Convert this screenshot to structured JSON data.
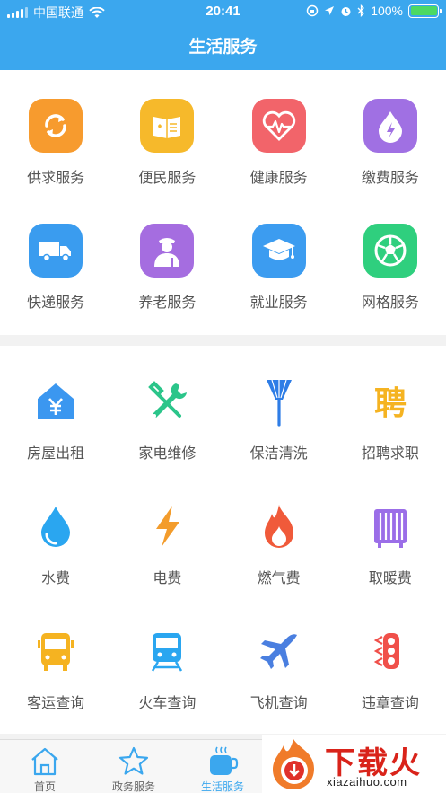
{
  "status": {
    "carrier": "中国联通",
    "time": "20:41",
    "battery": "100%"
  },
  "header": {
    "title": "生活服务"
  },
  "section1": [
    {
      "label": "供求服务",
      "icon": "exchange-icon",
      "color": "#f79b2e"
    },
    {
      "label": "便民服务",
      "icon": "book-icon",
      "color": "#f6b92b"
    },
    {
      "label": "健康服务",
      "icon": "heart-icon",
      "color": "#f2646a"
    },
    {
      "label": "缴费服务",
      "icon": "drop-icon",
      "color": "#a070e3"
    },
    {
      "label": "快递服务",
      "icon": "truck-icon",
      "color": "#3a9cef"
    },
    {
      "label": "养老服务",
      "icon": "elder-icon",
      "color": "#a56de0"
    },
    {
      "label": "就业服务",
      "icon": "graduation-cap-icon",
      "color": "#3c9cf0"
    },
    {
      "label": "网格服务",
      "icon": "ball-icon",
      "color": "#2fcf7e"
    }
  ],
  "section2": [
    {
      "label": "房屋出租",
      "icon": "house-yuan-icon",
      "color": "#3b97f0"
    },
    {
      "label": "家电维修",
      "icon": "tools-icon",
      "color": "#2bc58a"
    },
    {
      "label": "保洁清洗",
      "icon": "broom-icon",
      "color": "#2e7de6"
    },
    {
      "label": "招聘求职",
      "icon": "recruit-icon",
      "color": "#f5b321",
      "glyph": "聘"
    },
    {
      "label": "水费",
      "icon": "water-drop-icon",
      "color": "#2aa6f0"
    },
    {
      "label": "电费",
      "icon": "lightning-icon",
      "color": "#f39c2c"
    },
    {
      "label": "燃气费",
      "icon": "flame-icon",
      "color": "#f05a3a"
    },
    {
      "label": "取暖费",
      "icon": "radiator-icon",
      "color": "#9b6ee8"
    },
    {
      "label": "客运查询",
      "icon": "bus-icon",
      "color": "#f5b321"
    },
    {
      "label": "火车查询",
      "icon": "train-icon",
      "color": "#2aa6f0"
    },
    {
      "label": "飞机查询",
      "icon": "airplane-icon",
      "color": "#4a7fe0"
    },
    {
      "label": "违章查询",
      "icon": "traffic-light-icon",
      "color": "#f0504a"
    }
  ],
  "tabs": [
    {
      "label": "首页",
      "icon": "home-icon",
      "active": false
    },
    {
      "label": "政务服务",
      "icon": "star-icon",
      "active": false
    },
    {
      "label": "生活服务",
      "icon": "cup-icon",
      "active": true
    }
  ],
  "watermark": {
    "text": "下载火",
    "url": "xiazaihuo.com"
  }
}
